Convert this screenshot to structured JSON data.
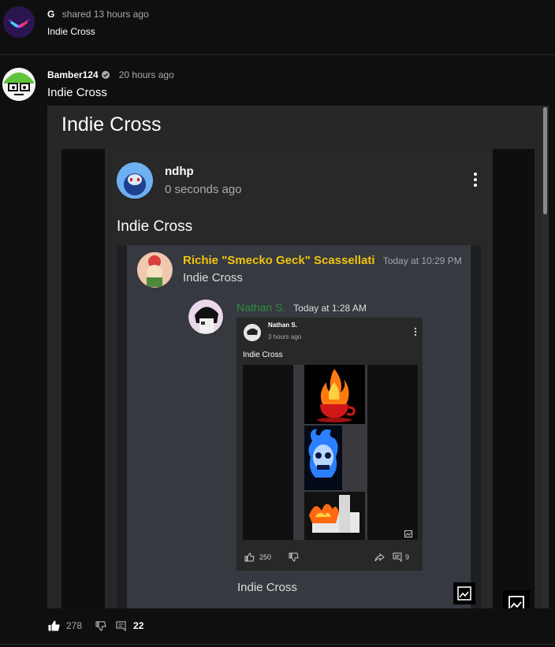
{
  "share": {
    "user": "G",
    "meta": "shared 13 hours ago",
    "text": "Indie Cross"
  },
  "post": {
    "user": "Bamber124",
    "time": "20 hours ago",
    "text": "Indie Cross",
    "likes": "278",
    "comments": "22"
  },
  "embed1": {
    "title": "Indie Cross",
    "user": "ndhp",
    "time": "0 seconds ago",
    "text": "Indie Cross",
    "bottom_text": "Indie Cross"
  },
  "discord": {
    "user1": "Richie \"Smecko Geck\" Scassellati",
    "time1": "Today at 10:29 PM",
    "msg1": "Indie Cross",
    "user2": "Nathan S.",
    "time2": "Today at 1:28 AM"
  },
  "inner_post": {
    "user": "Nathan S.",
    "time": "3 hours ago",
    "text": "Indie Cross",
    "likes": "250",
    "comments": "9"
  },
  "colors": {
    "bg": "#0f0f0f",
    "card": "#272727",
    "discord_bg": "#36393f",
    "discord_name1": "#f1c40f",
    "discord_name2": "#2e8b3e"
  }
}
